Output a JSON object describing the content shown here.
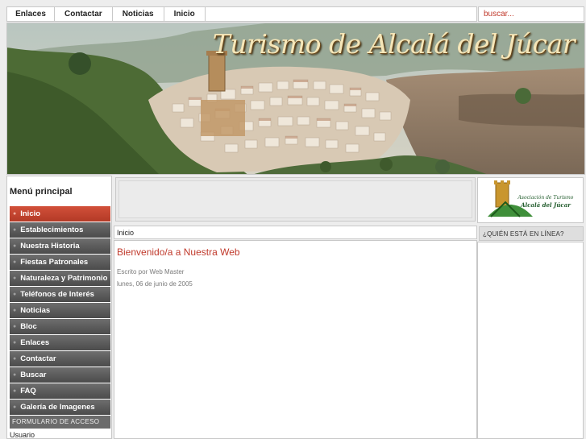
{
  "topnav": {
    "items": [
      "Enlaces",
      "Contactar",
      "Noticias",
      "Inicio"
    ]
  },
  "search": {
    "placeholder": "buscar..."
  },
  "banner": {
    "title": "Turismo de Alcalá del Júcar"
  },
  "sidebar": {
    "title": "Menú principal",
    "items": [
      {
        "label": "Inicio",
        "active": true
      },
      {
        "label": "Establecimientos"
      },
      {
        "label": "Nuestra Historia"
      },
      {
        "label": "Fiestas Patronales"
      },
      {
        "label": "Naturaleza y Patrimonio"
      },
      {
        "label": "Teléfonos de Interés"
      },
      {
        "label": "Noticias"
      },
      {
        "label": "Bloc"
      },
      {
        "label": "Enlaces"
      },
      {
        "label": "Contactar"
      },
      {
        "label": "Buscar"
      },
      {
        "label": "FAQ"
      },
      {
        "label": "Galería de Imagenes"
      }
    ],
    "form_title": "FORMULARIO DE ACCESO",
    "user_label": "Usuario"
  },
  "breadcrumb": "Inicio",
  "article": {
    "title": "Bienvenido/a a Nuestra Web",
    "author": "Escrito por Web Master",
    "date": "lunes, 06 de junio de 2005"
  },
  "right": {
    "logo_text": [
      "Asociación de Turismo",
      "Alcalá del Júcar"
    ],
    "who_title": "¿QUIÉN ESTÁ EN LÍNEA?"
  },
  "colors": {
    "accent": "#c0392b",
    "menu": "#5a5a5a"
  }
}
